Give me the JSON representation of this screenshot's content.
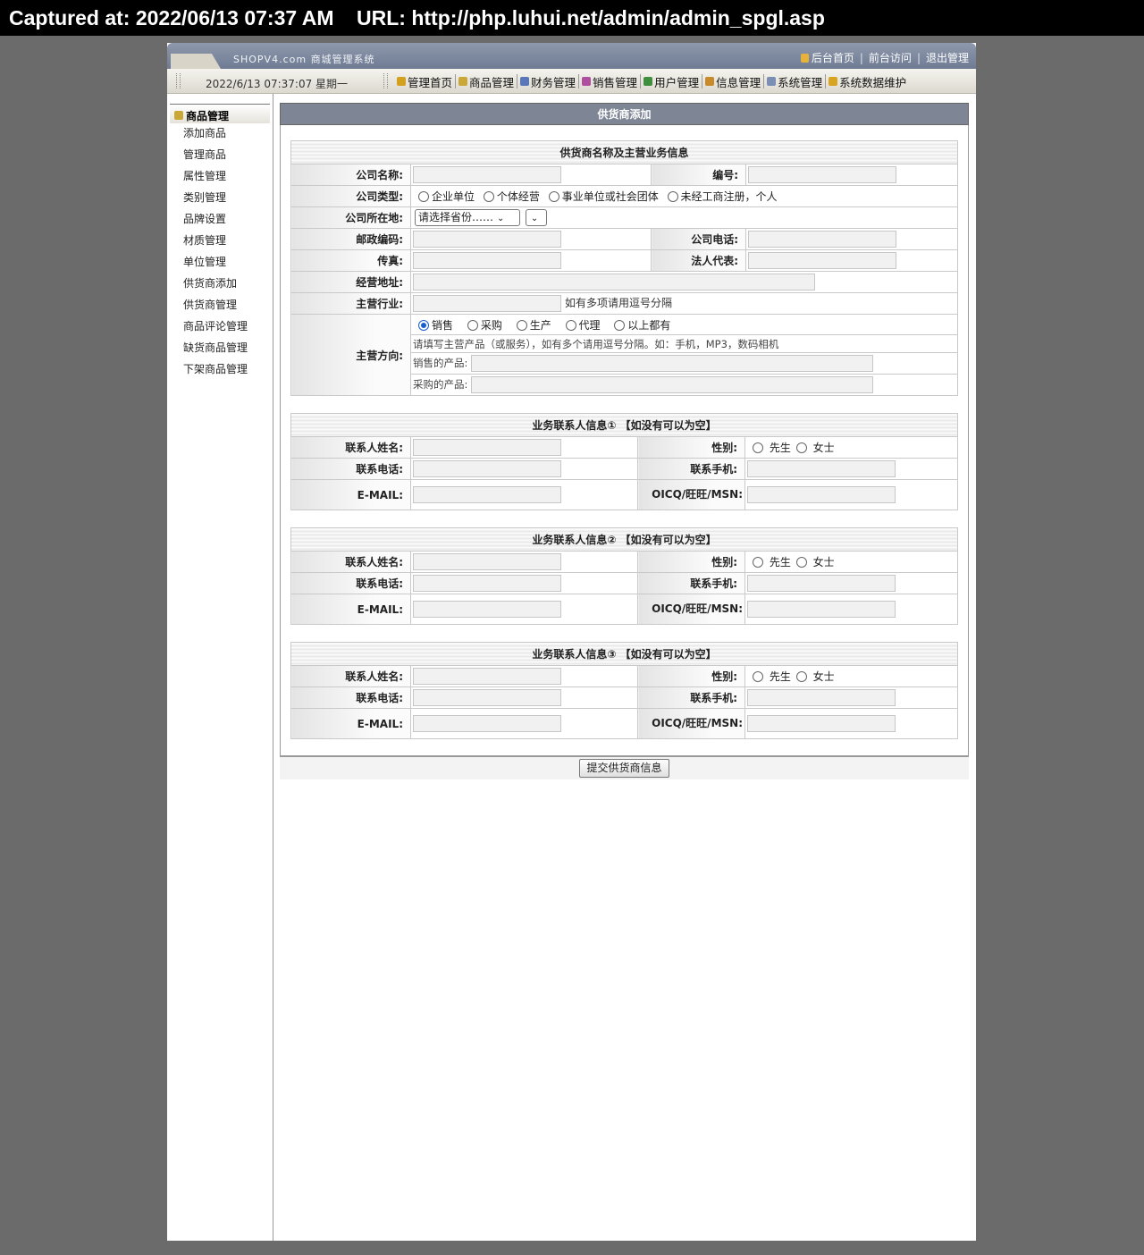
{
  "capture": {
    "text": "Captured at: 2022/06/13 07:37 AM    URL: http://php.luhui.net/admin/admin_spgl.asp"
  },
  "header": {
    "brand": "SHOPV4.com",
    "brand_suffix": "商城管理系统",
    "links": [
      "后台首页",
      "前台访问",
      "退出管理"
    ],
    "date": "2022/6/13 07:37:07 星期一",
    "nav": [
      {
        "label": "管理首页",
        "icon": "home-icon",
        "color": "#d4a020"
      },
      {
        "label": "商品管理",
        "icon": "goods-icon",
        "color": "#c9a838"
      },
      {
        "label": "财务管理",
        "icon": "finance-icon",
        "color": "#5b77b8"
      },
      {
        "label": "销售管理",
        "icon": "sales-chart-icon",
        "color": "#b04fa0"
      },
      {
        "label": "用户管理",
        "icon": "user-icon",
        "color": "#3f8f3f"
      },
      {
        "label": "信息管理",
        "icon": "info-icon",
        "color": "#c98a2b"
      },
      {
        "label": "系统管理",
        "icon": "system-icon",
        "color": "#7b8fb5"
      },
      {
        "label": "系统数据维护",
        "icon": "lock-icon",
        "color": "#d9a520"
      }
    ]
  },
  "sidebar": {
    "title": "商品管理",
    "items": [
      "添加商品",
      "管理商品",
      "属性管理",
      "类别管理",
      "品牌设置",
      "材质管理",
      "单位管理",
      "供货商添加",
      "供货商管理",
      "商品评论管理",
      "缺货商品管理",
      "下架商品管理"
    ]
  },
  "main": {
    "title": "供货商添加",
    "company": {
      "caption": "供货商名称及主营业务信息",
      "name_label": "公司名称:",
      "code_label": "编号:",
      "type_label": "公司类型:",
      "types": [
        "企业单位",
        "个体经营",
        "事业单位或社会团体",
        "未经工商注册，个人"
      ],
      "location_label": "公司所在地:",
      "province_placeholder": "请选择省份……",
      "zip_label": "邮政编码:",
      "phone_label": "公司电话:",
      "fax_label": "传真:",
      "legal_label": "法人代表:",
      "address_label": "经营地址:",
      "industry_label": "主营行业:",
      "industry_hint": "如有多项请用逗号分隔",
      "direction_label": "主营方向:",
      "directions": [
        "销售",
        "采购",
        "生产",
        "代理",
        "以上都有"
      ],
      "direction_hint": "请填写主营产品（或服务），如有多个请用逗号分隔。如：手机，MP3，数码相机",
      "sell_label": "销售的产品:",
      "buy_label": "采购的产品:"
    },
    "contacts": [
      {
        "caption": "业务联系人信息① 【如没有可以为空】"
      },
      {
        "caption": "业务联系人信息② 【如没有可以为空】"
      },
      {
        "caption": "业务联系人信息③ 【如没有可以为空】"
      }
    ],
    "contact_labels": {
      "name": "联系人姓名:",
      "gender": "性别:",
      "male": "先生",
      "female": "女士",
      "phone": "联系电话:",
      "mobile": "联系手机:",
      "email": "E-MAIL:",
      "im": "OICQ/旺旺/MSN:"
    },
    "submit": "提交供货商信息"
  }
}
